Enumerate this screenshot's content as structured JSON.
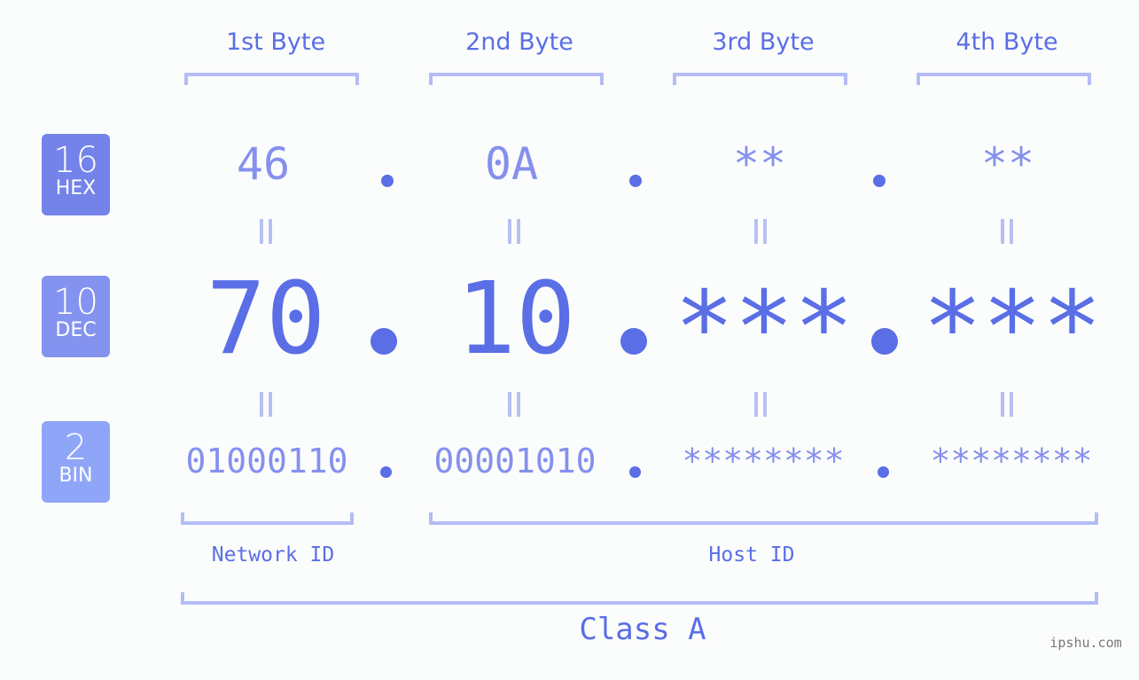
{
  "colors": {
    "primary": "#5a6ee6",
    "secondary": "#8590ee",
    "bracket": "#b3bcf5",
    "hex_badge": "#7383ea",
    "dec_badge": "#8493f0",
    "bin_badge": "#8fa6f8",
    "background": "#fbfdfc"
  },
  "byte_headers": [
    "1st Byte",
    "2nd Byte",
    "3rd Byte",
    "4th Byte"
  ],
  "badges": {
    "hex": {
      "number": "16",
      "label": "HEX"
    },
    "dec": {
      "number": "10",
      "label": "DEC"
    },
    "bin": {
      "number": "2",
      "label": "BIN"
    }
  },
  "ip": {
    "hex": [
      "46",
      "0A",
      "**",
      "**"
    ],
    "dec": [
      "70",
      "10",
      "***",
      "***"
    ],
    "bin": [
      "01000110",
      "00001010",
      "********",
      "********"
    ],
    "separator": "."
  },
  "labels": {
    "network_id": "Network ID",
    "host_id": "Host ID",
    "class": "Class A"
  },
  "watermark": "ipshu.com"
}
